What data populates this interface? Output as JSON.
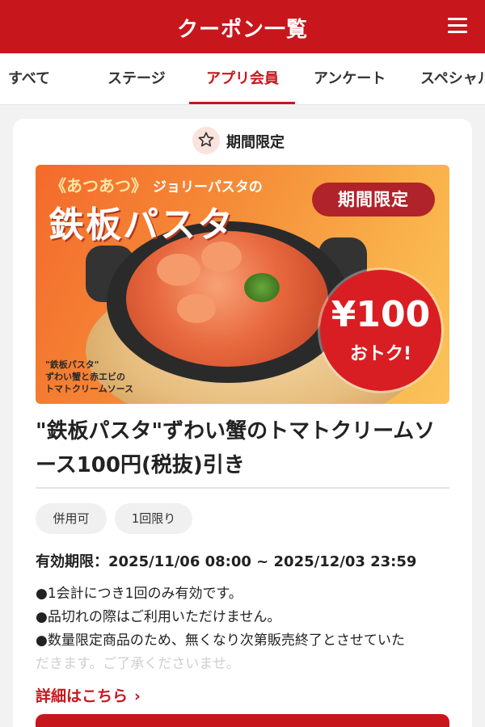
{
  "header": {
    "title": "クーポン一覧",
    "menu_icon": "hamburger-menu-icon"
  },
  "tabs": [
    {
      "label": "すべて",
      "active": false
    },
    {
      "label": "ステージ",
      "active": false
    },
    {
      "label": "アプリ会員",
      "active": true
    },
    {
      "label": "アンケート",
      "active": false
    },
    {
      "label": "スペシャル",
      "active": false
    }
  ],
  "coupon": {
    "badge": {
      "icon": "star-icon",
      "label": "期間限定"
    },
    "banner": {
      "kicker": "《あつあつ》",
      "kicker_sub": "ジョリーパスタの",
      "headline": "鉄板パスタ",
      "tag": "期間限定",
      "price_amount": "¥100",
      "price_save": "おトク!",
      "caption_line1": "\"鉄板パスタ\"",
      "caption_line2": "ずわい蟹と赤エビの",
      "caption_line3": "トマトクリームソース"
    },
    "title": "\"鉄板パスタ\"ずわい蟹のトマトクリームソース100円(税抜)引き",
    "chips": [
      "併用可",
      "1回限り"
    ],
    "validity": "有効期限：2025/11/06 08:00 ~ 2025/12/03 23:59",
    "notes": [
      "●1会計につき1回のみ有効です。",
      "●品切れの際はご利用いただけません。",
      "●数量限定商品のため、無くなり次第販売終了とさせていた",
      "だきます。ご了承くださいませ。"
    ],
    "details_link": "詳細はこちら",
    "details_icon": "chevron-right-icon"
  },
  "colors": {
    "brand_red": "#c8161d",
    "background": "#f2f2f2",
    "card": "#ffffff"
  }
}
